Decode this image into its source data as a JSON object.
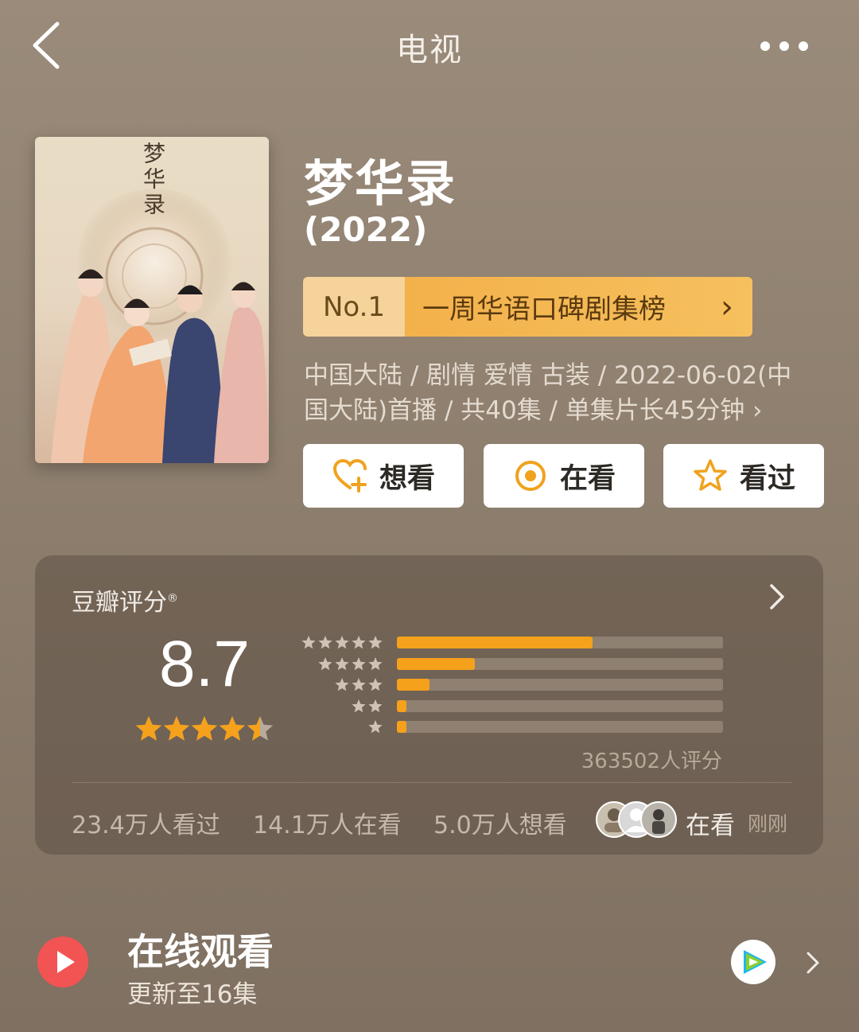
{
  "nav": {
    "title": "电视",
    "back_icon": "chevron-left-icon",
    "more_icon": "more-dots-icon"
  },
  "show": {
    "title": "梦华录",
    "year": "(2022)",
    "poster_title_text": "梦华录",
    "rank": {
      "no": "No.1",
      "text": "一周华语口碑剧集榜",
      "chevron": "›"
    },
    "meta_line1": "中国大陆 / 剧情 爱情 古装 / 2022-06-02(中",
    "meta_line2": "国大陆)首播 / 共40集 / 单集片长45分钟 ›"
  },
  "actions": [
    {
      "label": "想看",
      "icon": "heart-plus-icon"
    },
    {
      "label": "在看",
      "icon": "target-circle-icon"
    },
    {
      "label": "看过",
      "icon": "star-outline-icon"
    }
  ],
  "rating": {
    "title": "豆瓣评分",
    "registered_mark": "®",
    "score": "8.7",
    "stars_value": 4.5,
    "distribution": [
      {
        "stars": 5,
        "fraction": 0.6
      },
      {
        "stars": 4,
        "fraction": 0.24
      },
      {
        "stars": 3,
        "fraction": 0.1
      },
      {
        "stars": 2,
        "fraction": 0.03
      },
      {
        "stars": 1,
        "fraction": 0.03
      }
    ],
    "total": "363502人评分",
    "stats": {
      "watched": "23.4万人看过",
      "watching": "14.1万人在看",
      "want": "5.0万人想看"
    },
    "friends_status": "在看",
    "friends_time": "刚刚"
  },
  "online": {
    "title": "在线观看",
    "subtitle": "更新至16集",
    "play_icon": "play-icon",
    "platform_icon": "tencent-video-icon"
  },
  "colors": {
    "accent": "#f5a11c",
    "background": "#8f806f",
    "rank_banner": "#f3b14b"
  }
}
